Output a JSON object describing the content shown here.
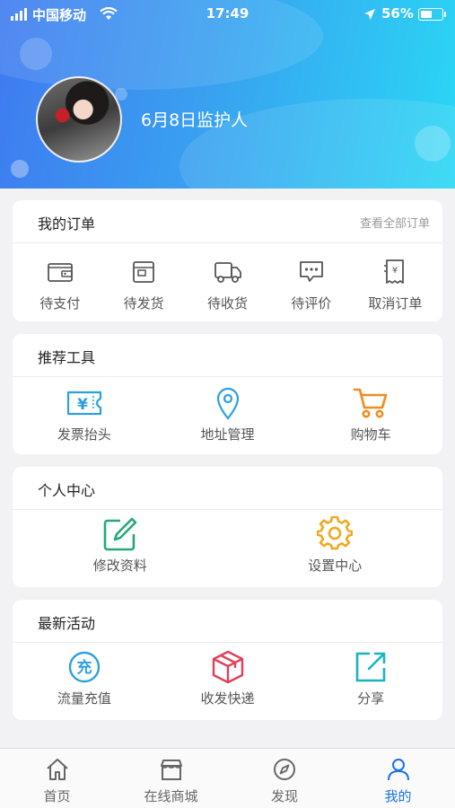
{
  "status_bar": {
    "carrier": "中国移动",
    "time": "17:49",
    "battery": "56%",
    "battery_level": 0.56
  },
  "profile": {
    "name": "6月8日监护人"
  },
  "orders": {
    "title": "我的订单",
    "view_all": "查看全部订单",
    "items": [
      {
        "label": "待支付",
        "icon": "wallet-icon"
      },
      {
        "label": "待发货",
        "icon": "box-icon"
      },
      {
        "label": "待收货",
        "icon": "truck-icon"
      },
      {
        "label": "待评价",
        "icon": "comment-icon"
      },
      {
        "label": "取消订单",
        "icon": "receipt-icon"
      }
    ]
  },
  "tools": {
    "title": "推荐工具",
    "items": [
      {
        "label": "发票抬头",
        "icon": "invoice-icon"
      },
      {
        "label": "地址管理",
        "icon": "location-pin-icon"
      },
      {
        "label": "购物车",
        "icon": "cart-icon"
      }
    ]
  },
  "personal": {
    "title": "个人中心",
    "items": [
      {
        "label": "修改资料",
        "icon": "edit-icon"
      },
      {
        "label": "设置中心",
        "icon": "gear-icon"
      }
    ]
  },
  "activities": {
    "title": "最新活动",
    "items": [
      {
        "label": "流量充值",
        "icon": "recharge-icon",
        "glyph": "充"
      },
      {
        "label": "收发快递",
        "icon": "package-icon"
      },
      {
        "label": "分享",
        "icon": "share-icon"
      }
    ]
  },
  "tabbar": {
    "tabs": [
      {
        "label": "首页",
        "icon": "home-icon"
      },
      {
        "label": "在线商城",
        "icon": "store-icon"
      },
      {
        "label": "发现",
        "icon": "compass-icon"
      },
      {
        "label": "我的",
        "icon": "user-icon",
        "active": true
      }
    ]
  },
  "colors": {
    "accent": "#1a73e8",
    "header_start": "#3f7af0",
    "header_end": "#2ad7f4",
    "orange": "#f08c1e",
    "green": "#27a87a",
    "red": "#e0405a",
    "teal": "#18b5c0"
  }
}
